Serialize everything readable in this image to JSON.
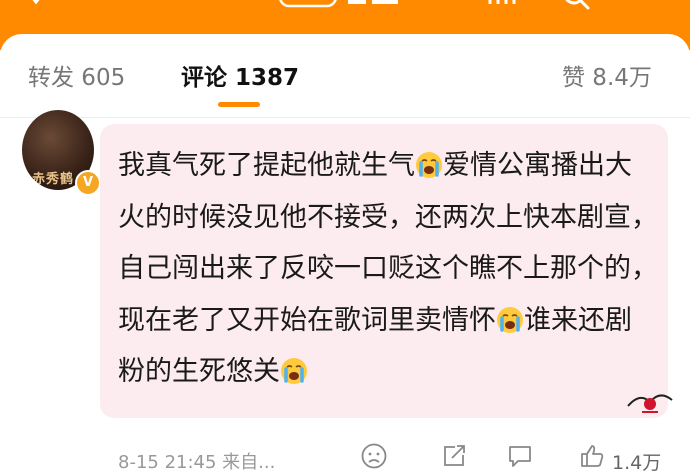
{
  "tabs": {
    "repost": "转发 605",
    "comments": "评论 1387",
    "likes": "赞 8.4万"
  },
  "user": {
    "avatar_text": "赤秀鹤",
    "badge": "V"
  },
  "comment": {
    "part1": "我真气死了提起他就生气",
    "part2": "爱情公寓播出大火的时候没见他不接受，还两次上快本剧宣，自己闯出来了反咬一口贬这个瞧不上那个的，现在老了又开始在歌词里卖情怀",
    "part3": "谁来还剧粉的生死悠关"
  },
  "footer": {
    "meta": "8-15 21:45 来自...",
    "like_count": "1.4万"
  },
  "colors": {
    "accent": "#ff8a00",
    "bubble": "#fcecef"
  },
  "icons": [
    "crying-emoji-icon",
    "dislike-icon",
    "share-icon",
    "comment-icon",
    "like-icon"
  ]
}
